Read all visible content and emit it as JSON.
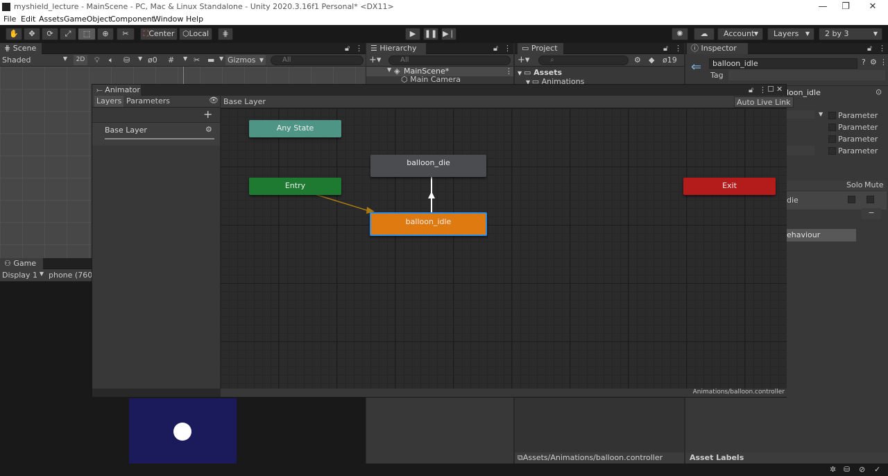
{
  "window": {
    "title": "myshield_lecture - MainScene - PC, Mac & Linux Standalone - Unity 2020.3.16f1 Personal* <DX11>",
    "minimize": "—",
    "restore": "❐",
    "close": "✕"
  },
  "menu": [
    "File",
    "Edit",
    "Assets",
    "GameObject",
    "Component",
    "Window",
    "Help"
  ],
  "toolbar": {
    "pivot_label": "Center",
    "space_label": "Local",
    "account_label": "Account",
    "layers_label": "Layers",
    "layout_label": "2 by 3"
  },
  "scene": {
    "tab": "Scene",
    "shading": "Shaded",
    "mode_2d": "2D",
    "hidden_count": "0",
    "gizmos": "Gizmos",
    "search_placeholder": "All"
  },
  "game": {
    "tab": "Game",
    "display": "Display 1",
    "resolution": "phone (760x"
  },
  "hierarchy": {
    "tab": "Hierarchy",
    "search_placeholder": "All",
    "scene_name": "MainScene*",
    "items": [
      "Main Camera"
    ]
  },
  "project": {
    "tab": "Project",
    "hidden_count": "19",
    "root": "Assets",
    "items": [
      "Animations"
    ],
    "path": "Assets/Animations/balloon.controller"
  },
  "inspector": {
    "tab": "Inspector",
    "object_name": "balloon_idle",
    "tag_label": "Tag",
    "state_name_partial": "loon_idle",
    "params": [
      "Parameter",
      "Parameter",
      "Parameter",
      "Parameter"
    ],
    "solo_label": "Solo",
    "mute_label": "Mute",
    "transition_partial": "die",
    "minus": "−",
    "behaviour_partial": "ehaviour",
    "asset_labels": "Asset Labels"
  },
  "animator": {
    "tab": "Animator",
    "layers_tab": "Layers",
    "parameters_tab": "Parameters",
    "breadcrumb": "Base Layer",
    "auto_live_link": "Auto Live Link",
    "layer_name": "Base Layer",
    "add": "+",
    "controller_path": "Animations/balloon.controller",
    "nodes": {
      "any_state": "Any State",
      "entry": "Entry",
      "exit": "Exit",
      "balloon_die": "balloon_die",
      "balloon_idle": "balloon_idle"
    }
  },
  "colors": {
    "any_state": "#4f9585",
    "entry": "#1e7a31",
    "exit": "#b41b1b",
    "default_state": "#4b4c4f",
    "selected_state": "#df7a10",
    "selection_outline": "#2f8ee8",
    "game_bg": "#1b1b5c"
  }
}
